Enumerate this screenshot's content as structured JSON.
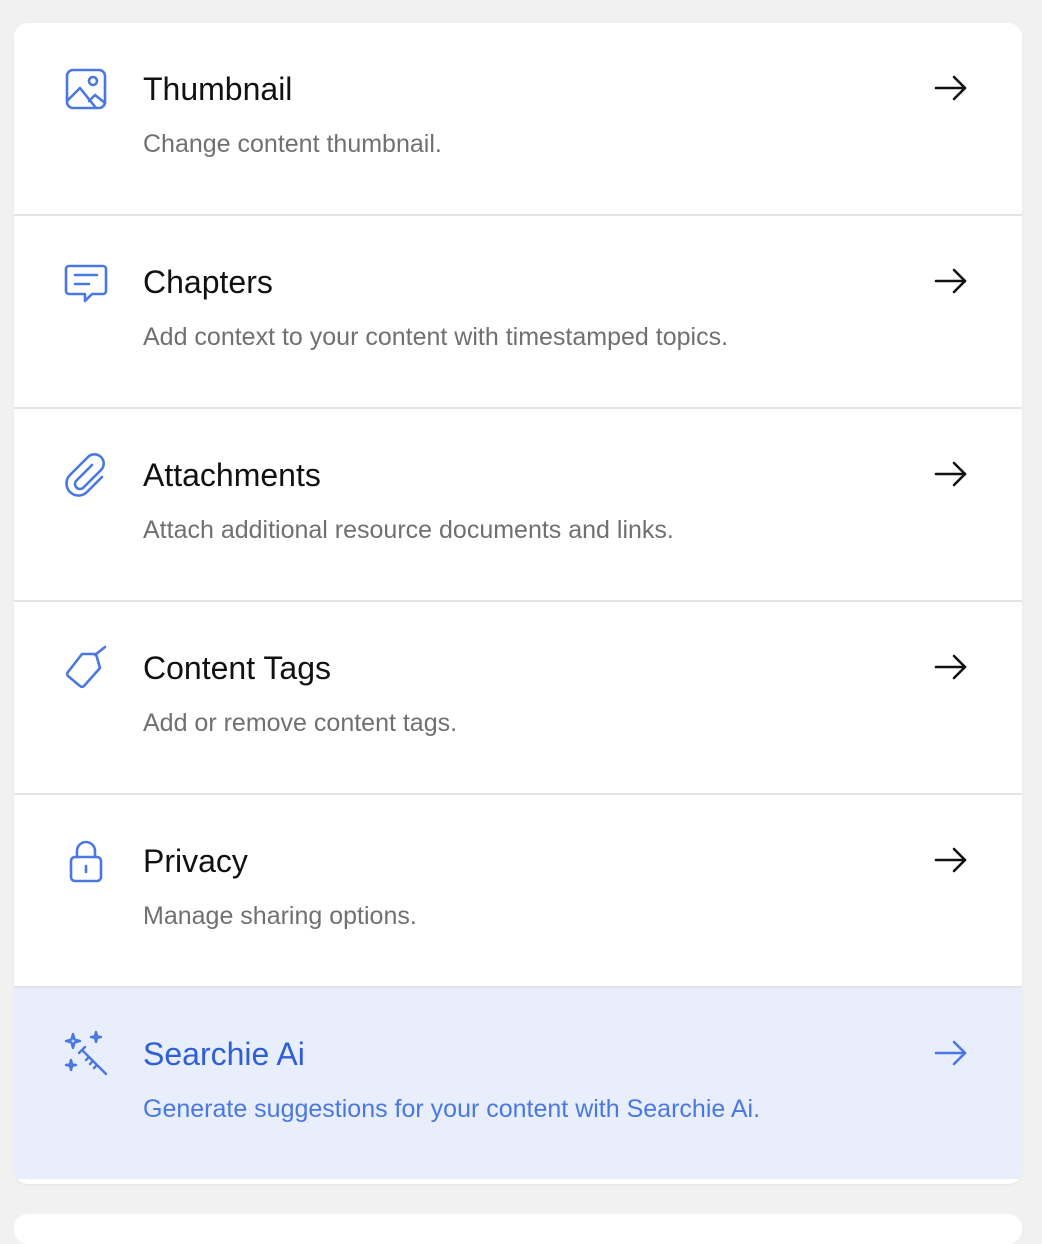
{
  "colors": {
    "accent": "#4a78e0",
    "accent_dark": "#2f5fd8",
    "highlight_bg": "#e8eefc",
    "title_text": "#111111",
    "desc_text": "#707070"
  },
  "menu": {
    "items": [
      {
        "icon": "image-icon",
        "title": "Thumbnail",
        "description": "Change content thumbnail."
      },
      {
        "icon": "chat-bubble-icon",
        "title": "Chapters",
        "description": "Add context to your content with timestamped topics."
      },
      {
        "icon": "paperclip-icon",
        "title": "Attachments",
        "description": "Attach additional resource documents and links."
      },
      {
        "icon": "tag-icon",
        "title": "Content Tags",
        "description": "Add or remove content tags."
      },
      {
        "icon": "lock-icon",
        "title": "Privacy",
        "description": "Manage sharing options."
      },
      {
        "icon": "magic-wand-icon",
        "title": "Searchie Ai",
        "description": "Generate suggestions for your content with Searchie Ai.",
        "highlighted": true
      }
    ]
  }
}
